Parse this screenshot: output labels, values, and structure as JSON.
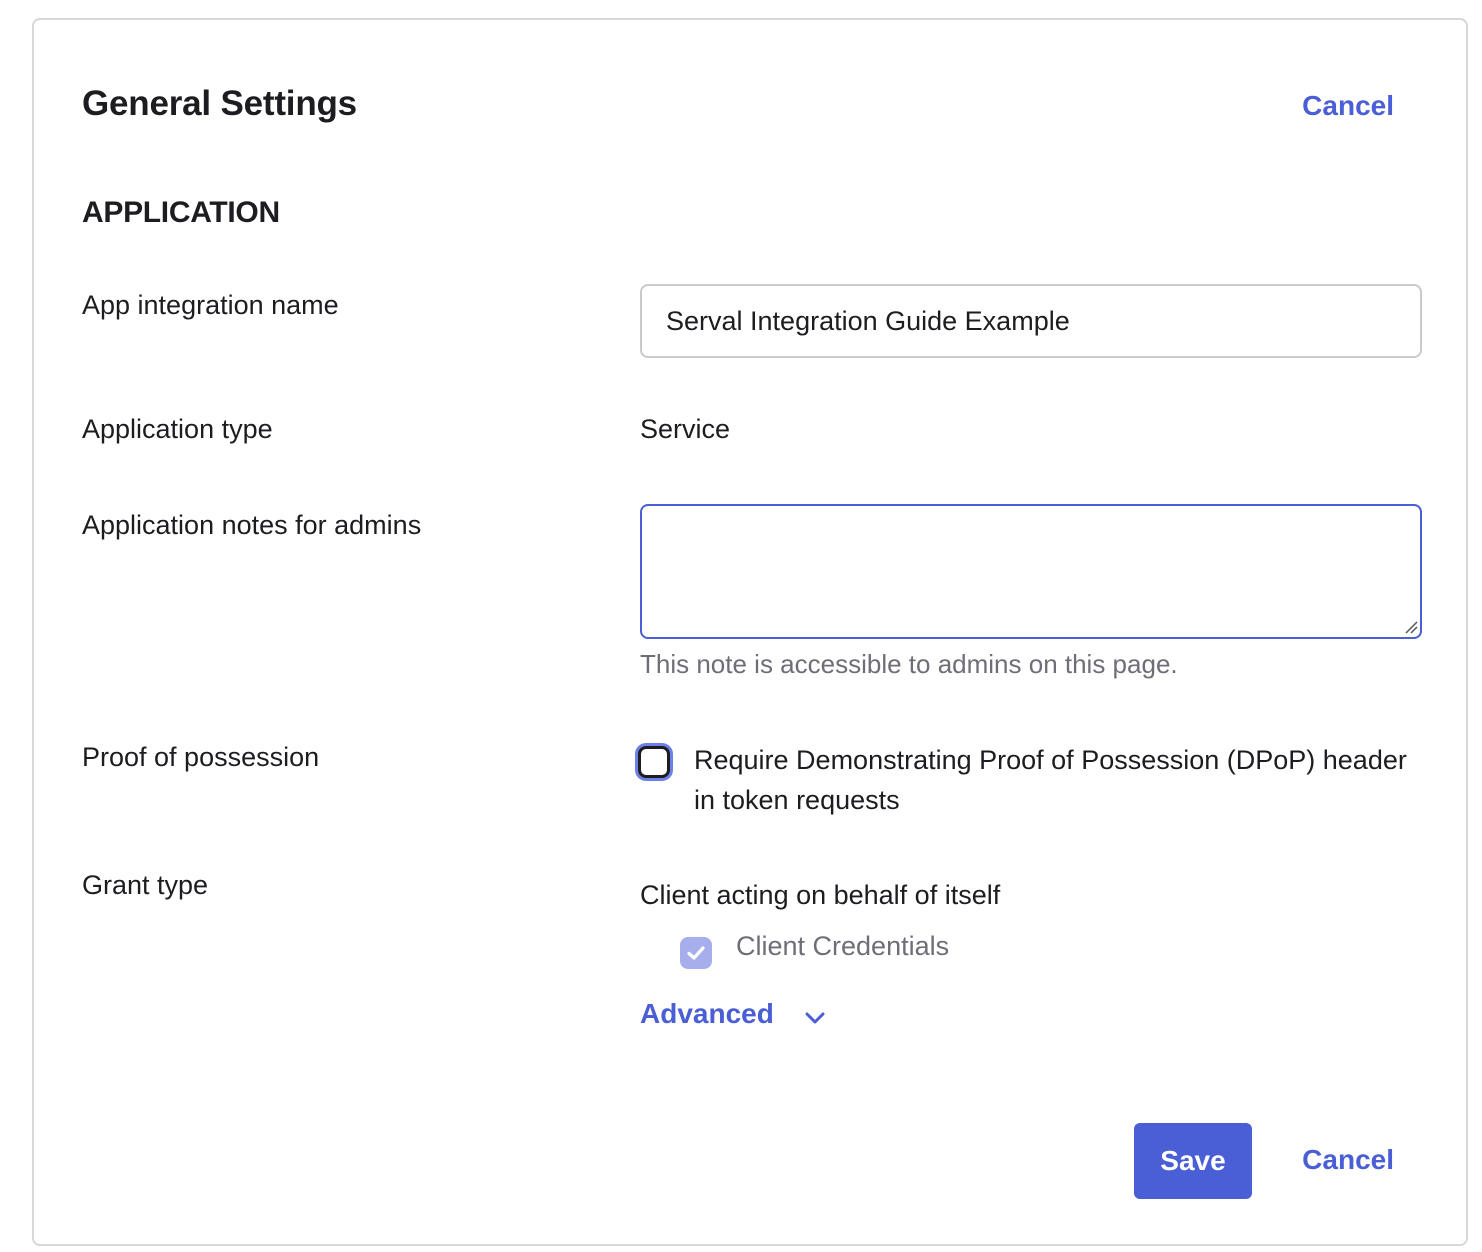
{
  "header": {
    "title": "General Settings",
    "cancel_label": "Cancel"
  },
  "section": {
    "heading": "APPLICATION"
  },
  "fields": {
    "app_name": {
      "label": "App integration name",
      "value": "Serval Integration Guide Example"
    },
    "app_type": {
      "label": "Application type",
      "value": "Service"
    },
    "notes": {
      "label": "Application notes for admins",
      "value": "",
      "hint": "This note is accessible to admins on this page."
    },
    "dpop": {
      "label": "Proof of possession",
      "checkbox_label": "Require Demonstrating Proof of Possession (DPoP) header in token requests",
      "checked": false
    },
    "grant_type": {
      "label": "Grant type",
      "subheading": "Client acting on behalf of itself",
      "option_label": "Client Credentials",
      "option_checked": true,
      "advanced_label": "Advanced",
      "advanced_icon": "chevron-down-icon"
    }
  },
  "footer": {
    "save_label": "Save",
    "cancel_label": "Cancel"
  },
  "colors": {
    "accent": "#4a5ed6",
    "checked_disabled": "#a6afec",
    "hint_text": "#6e6e78",
    "border": "#d7d7dc"
  }
}
